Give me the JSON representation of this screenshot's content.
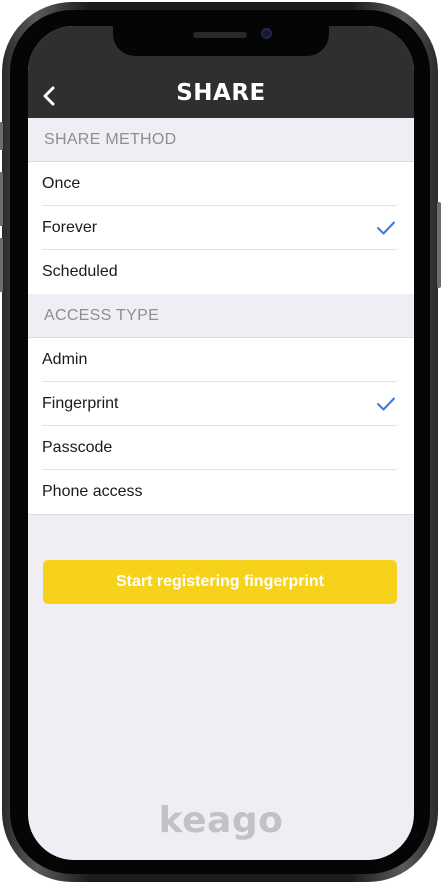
{
  "header": {
    "title": "SHARE",
    "back_icon": "chevron-left-icon"
  },
  "share_method": {
    "heading": "SHARE METHOD",
    "options": [
      {
        "label": "Once",
        "selected": false
      },
      {
        "label": "Forever",
        "selected": true
      },
      {
        "label": "Scheduled",
        "selected": false
      }
    ]
  },
  "access_type": {
    "heading": "ACCESS TYPE",
    "options": [
      {
        "label": "Admin",
        "selected": false
      },
      {
        "label": "Fingerprint",
        "selected": true
      },
      {
        "label": "Passcode",
        "selected": false
      },
      {
        "label": "Phone access",
        "selected": false
      }
    ]
  },
  "action": {
    "label": "Start registering fingerprint"
  },
  "brand": {
    "logo_text": "keago"
  },
  "colors": {
    "navbar": "#2f2f2f",
    "accent_yellow": "#f6d31a",
    "checkmark": "#2f7cf6",
    "background": "#efeef4",
    "logo": "#c2c1c7"
  },
  "icons": {
    "selected_mark": "checkmark-icon"
  }
}
